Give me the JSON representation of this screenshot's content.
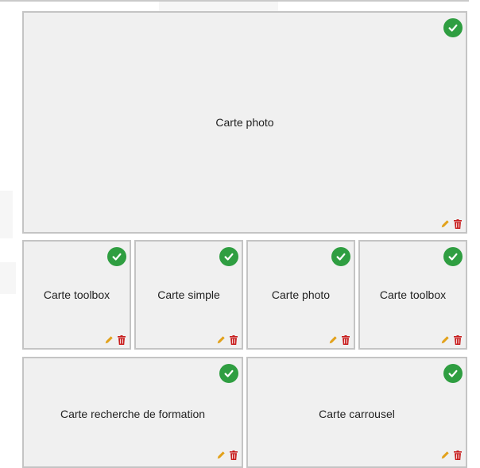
{
  "cards": [
    {
      "label": "Carte photo",
      "status_icon": "check-circle-icon",
      "edit_icon": "pencil-icon",
      "delete_icon": "trash-icon"
    },
    {
      "label": "Carte toolbox",
      "status_icon": "check-circle-icon",
      "edit_icon": "pencil-icon",
      "delete_icon": "trash-icon"
    },
    {
      "label": "Carte simple",
      "status_icon": "check-circle-icon",
      "edit_icon": "pencil-icon",
      "delete_icon": "trash-icon"
    },
    {
      "label": "Carte photo",
      "status_icon": "check-circle-icon",
      "edit_icon": "pencil-icon",
      "delete_icon": "trash-icon"
    },
    {
      "label": "Carte toolbox",
      "status_icon": "check-circle-icon",
      "edit_icon": "pencil-icon",
      "delete_icon": "trash-icon"
    },
    {
      "label": "Carte recherche de formation",
      "status_icon": "check-circle-icon",
      "edit_icon": "pencil-icon",
      "delete_icon": "trash-icon"
    },
    {
      "label": "Carte carrousel",
      "status_icon": "check-circle-icon",
      "edit_icon": "pencil-icon",
      "delete_icon": "trash-icon"
    }
  ],
  "colors": {
    "check": "#2f9e41",
    "pencil": "#e2a11a",
    "trash": "#c81e1e",
    "card_bg": "#f0f0f0",
    "card_border": "#c4c4c4"
  }
}
